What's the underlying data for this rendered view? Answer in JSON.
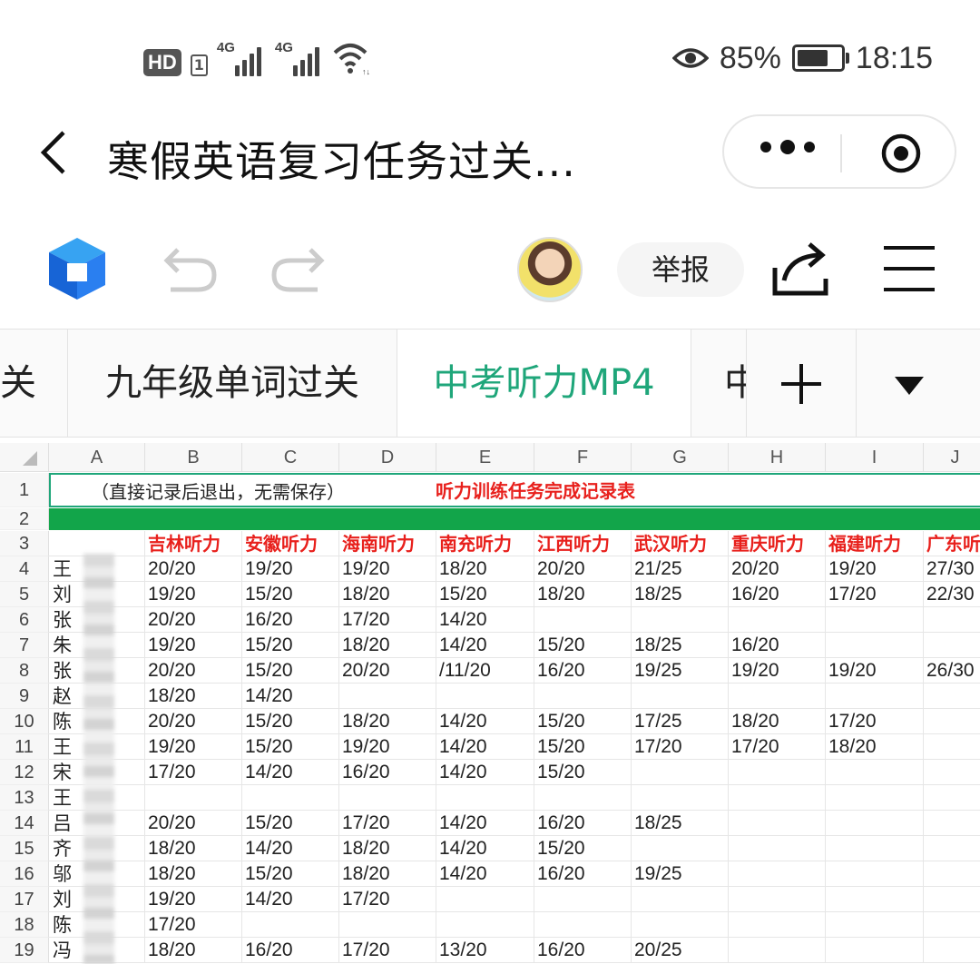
{
  "status_bar": {
    "hd": "HD",
    "sim": "1",
    "net1": "4G",
    "net2": "4G",
    "battery_percent": "85%",
    "battery_level": 0.85,
    "time": "18:15"
  },
  "titlebar": {
    "title": "寒假英语复习任务过关..."
  },
  "toolbar": {
    "report_label": "举报"
  },
  "tabs": [
    {
      "label": "关",
      "active": false
    },
    {
      "label": "九年级单词过关",
      "active": false
    },
    {
      "label": "中考听力MP4",
      "active": true
    },
    {
      "label": "中",
      "active": false
    }
  ],
  "colors": {
    "accent": "#1fa67a",
    "header_red": "#e8201c",
    "green_bar": "#12a54a"
  },
  "sheet": {
    "columns": [
      "A",
      "B",
      "C",
      "D",
      "E",
      "F",
      "G",
      "H",
      "I",
      "J"
    ],
    "row1_note": "（直接记录后退出，无需保存）",
    "row1_title": "听力训练任务完成记录表",
    "headers": [
      "",
      "吉林听力",
      "安徽听力",
      "海南听力",
      "南充听力",
      "江西听力",
      "武汉听力",
      "重庆听力",
      "福建听力",
      "广东听"
    ],
    "rows": [
      {
        "num": "4",
        "name": "王",
        "scores": [
          "20/20",
          "19/20",
          "19/20",
          "18/20",
          "20/20",
          "21/25",
          "20/20",
          "19/20",
          "27/30"
        ]
      },
      {
        "num": "5",
        "name": "刘",
        "scores": [
          "19/20",
          "15/20",
          "18/20",
          "15/20",
          "18/20",
          "18/25",
          "16/20",
          "17/20",
          "22/30"
        ]
      },
      {
        "num": "6",
        "name": "张",
        "scores": [
          "20/20",
          "16/20",
          "17/20",
          "14/20",
          "",
          "",
          "",
          "",
          ""
        ]
      },
      {
        "num": "7",
        "name": "朱",
        "scores": [
          "19/20",
          "15/20",
          "18/20",
          "14/20",
          "15/20",
          "18/25",
          "16/20",
          "",
          ""
        ]
      },
      {
        "num": "8",
        "name": "张",
        "scores": [
          "20/20",
          "15/20",
          "20/20",
          "/11/20",
          "16/20",
          "19/25",
          "19/20",
          "19/20",
          "26/30"
        ]
      },
      {
        "num": "9",
        "name": "赵",
        "scores": [
          "18/20",
          "14/20",
          "",
          "",
          "",
          "",
          "",
          "",
          ""
        ]
      },
      {
        "num": "10",
        "name": "陈",
        "scores": [
          "20/20",
          "15/20",
          "18/20",
          "14/20",
          "15/20",
          "17/25",
          "18/20",
          "17/20",
          ""
        ]
      },
      {
        "num": "11",
        "name": "王",
        "scores": [
          "19/20",
          "15/20",
          "19/20",
          "14/20",
          "15/20",
          "17/20",
          "17/20",
          "18/20",
          ""
        ]
      },
      {
        "num": "12",
        "name": "宋",
        "scores": [
          "17/20",
          "14/20",
          "16/20",
          "14/20",
          "15/20",
          "",
          "",
          "",
          ""
        ]
      },
      {
        "num": "13",
        "name": "王",
        "scores": [
          "",
          "",
          "",
          "",
          "",
          "",
          "",
          "",
          ""
        ]
      },
      {
        "num": "14",
        "name": "吕",
        "scores": [
          "20/20",
          "15/20",
          "17/20",
          "14/20",
          "16/20",
          "18/25",
          "",
          "",
          ""
        ]
      },
      {
        "num": "15",
        "name": "齐",
        "scores": [
          "18/20",
          "14/20",
          "18/20",
          "14/20",
          "15/20",
          "",
          "",
          "",
          ""
        ]
      },
      {
        "num": "16",
        "name": "邬",
        "scores": [
          "18/20",
          "15/20",
          "18/20",
          "14/20",
          "16/20",
          "19/25",
          "",
          "",
          ""
        ]
      },
      {
        "num": "17",
        "name": "刘",
        "scores": [
          "19/20",
          "14/20",
          "17/20",
          "",
          "",
          "",
          "",
          "",
          ""
        ]
      },
      {
        "num": "18",
        "name": "陈",
        "scores": [
          "17/20",
          "",
          "",
          "",
          "",
          "",
          "",
          "",
          ""
        ]
      },
      {
        "num": "19",
        "name": "冯",
        "scores": [
          "18/20",
          "16/20",
          "17/20",
          "13/20",
          "16/20",
          "20/25",
          "",
          "",
          ""
        ]
      }
    ]
  }
}
